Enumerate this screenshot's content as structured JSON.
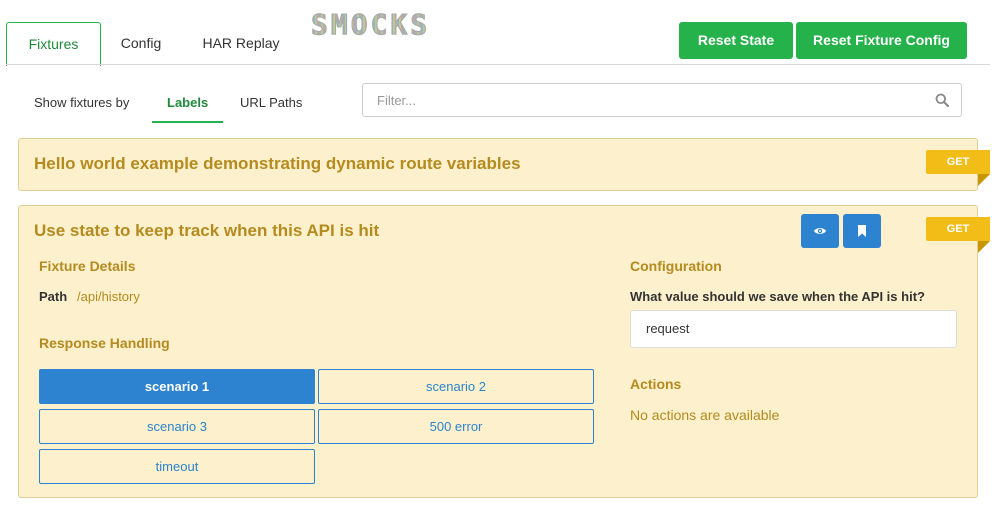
{
  "header": {
    "tabs": [
      {
        "label": "Fixtures",
        "active": true
      },
      {
        "label": "Config",
        "active": false
      },
      {
        "label": "HAR Replay",
        "active": false
      }
    ],
    "logo_text": "SMOCKS",
    "reset_state_label": "Reset State",
    "reset_fixture_config_label": "Reset Fixture Config"
  },
  "subnav": {
    "show_by_label": "Show fixtures by",
    "tabs": [
      {
        "label": "Labels",
        "active": true
      },
      {
        "label": "URL Paths",
        "active": false
      }
    ],
    "filter_placeholder": "Filter...",
    "filter_value": ""
  },
  "fixtures": [
    {
      "title": "Hello world example demonstrating dynamic route variables",
      "method": "GET",
      "expanded": false
    },
    {
      "title": "Use state to keep track when this API is hit",
      "method": "GET",
      "expanded": true,
      "actions_icons": [
        "eye-icon",
        "bookmark-icon"
      ],
      "details_heading": "Fixture Details",
      "path_label": "Path",
      "path_value": "/api/history",
      "response_heading": "Response Handling",
      "scenarios": [
        {
          "label": "scenario 1",
          "active": true
        },
        {
          "label": "scenario 2",
          "active": false
        },
        {
          "label": "scenario 3",
          "active": false
        },
        {
          "label": "500 error",
          "active": false
        },
        {
          "label": "timeout",
          "active": false
        }
      ],
      "config_heading": "Configuration",
      "config_question": "What value should we save when the API is hit?",
      "config_value": "request",
      "actions_heading": "Actions",
      "no_actions_text": "No actions are available"
    }
  ],
  "colors": {
    "green": "#25b24a",
    "blue": "#2d83cf",
    "card_bg": "#fcf1cc",
    "gold_text": "#b58a1f",
    "badge": "#f3bd17"
  }
}
